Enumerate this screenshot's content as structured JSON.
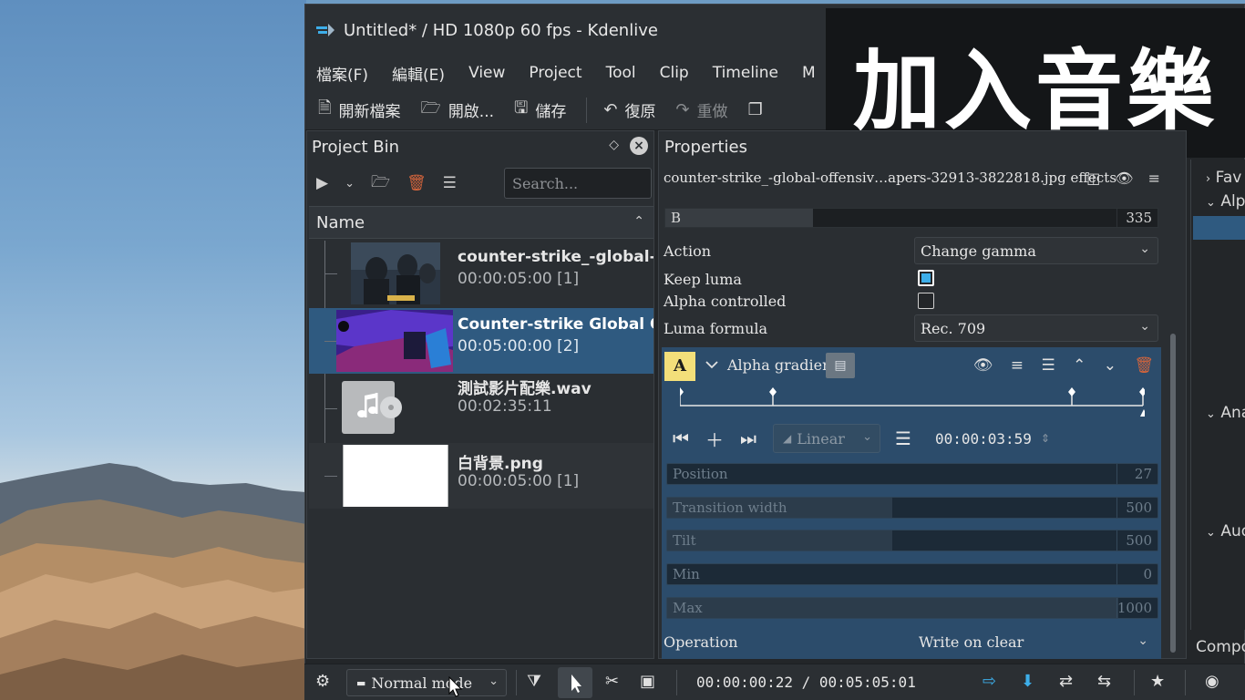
{
  "window": {
    "title": "Untitled* / HD 1080p 60 fps - Kdenlive"
  },
  "menu": [
    "檔案(F)",
    "編輯(E)",
    "View",
    "Project",
    "Tool",
    "Clip",
    "Timeline",
    "M"
  ],
  "toolbar": {
    "new": "開新檔案",
    "open": "開啟...",
    "save": "儲存",
    "undo": "復原",
    "redo": "重做"
  },
  "overlay": {
    "caption": "加入音樂"
  },
  "bin": {
    "title": "Project Bin",
    "search_placeholder": "Search...",
    "column": "Name",
    "items": [
      {
        "name": "counter-strike_-global-offensive",
        "duration": "00:00:05:00 [1]",
        "thumb": "cs-soldiers"
      },
      {
        "name": "Counter-strike  Global Offensive",
        "duration": "00:05:00:00 [2]",
        "thumb": "cs-gameplay",
        "selected": true
      },
      {
        "name": "測試影片配樂.wav",
        "duration": "00:02:35:11",
        "thumb": "audio-file"
      },
      {
        "name": "白背景.png",
        "duration": "00:00:05:00 [1]",
        "thumb": "white-image"
      }
    ]
  },
  "properties": {
    "title": "Properties",
    "clip_line": "counter-strike_-global-offensiv…apers-32913-3822818.jpg effects",
    "b_param": {
      "label": "B",
      "value": "335",
      "fraction": 0.3
    },
    "action": {
      "label": "Action",
      "value": "Change gamma"
    },
    "keep_luma": {
      "label": "Keep luma",
      "checked": true
    },
    "alpha_controlled": {
      "label": "Alpha controlled",
      "checked": false
    },
    "luma_formula": {
      "label": "Luma formula",
      "value": "Rec. 709"
    },
    "effect": {
      "badge": "A",
      "name": "Alpha gradient",
      "interpolation": "Linear",
      "timecode": "00:00:03:59",
      "params": [
        {
          "label": "Position",
          "value": "27",
          "fraction": 0.0
        },
        {
          "label": "Transition width",
          "value": "500",
          "fraction": 0.5
        },
        {
          "label": "Tilt",
          "value": "500",
          "fraction": 0.5
        },
        {
          "label": "Min",
          "value": "0",
          "fraction": 0.0
        },
        {
          "label": "Max",
          "value": "1000",
          "fraction": 1.0
        }
      ],
      "operation": {
        "label": "Operation",
        "value": "Write on clear"
      }
    }
  },
  "right_panel": {
    "items": [
      "Fav",
      "Alp",
      "Ana",
      "Aud"
    ],
    "compo": "Compo"
  },
  "bottom": {
    "mode": "Normal mode",
    "timecode": "00:00:00:22 / 00:05:05:01"
  },
  "colors": {
    "accent": "#3daee9",
    "selection": "#2f5a80",
    "effect_panel": "#2c4c6b",
    "badge": "#f3df7a"
  }
}
